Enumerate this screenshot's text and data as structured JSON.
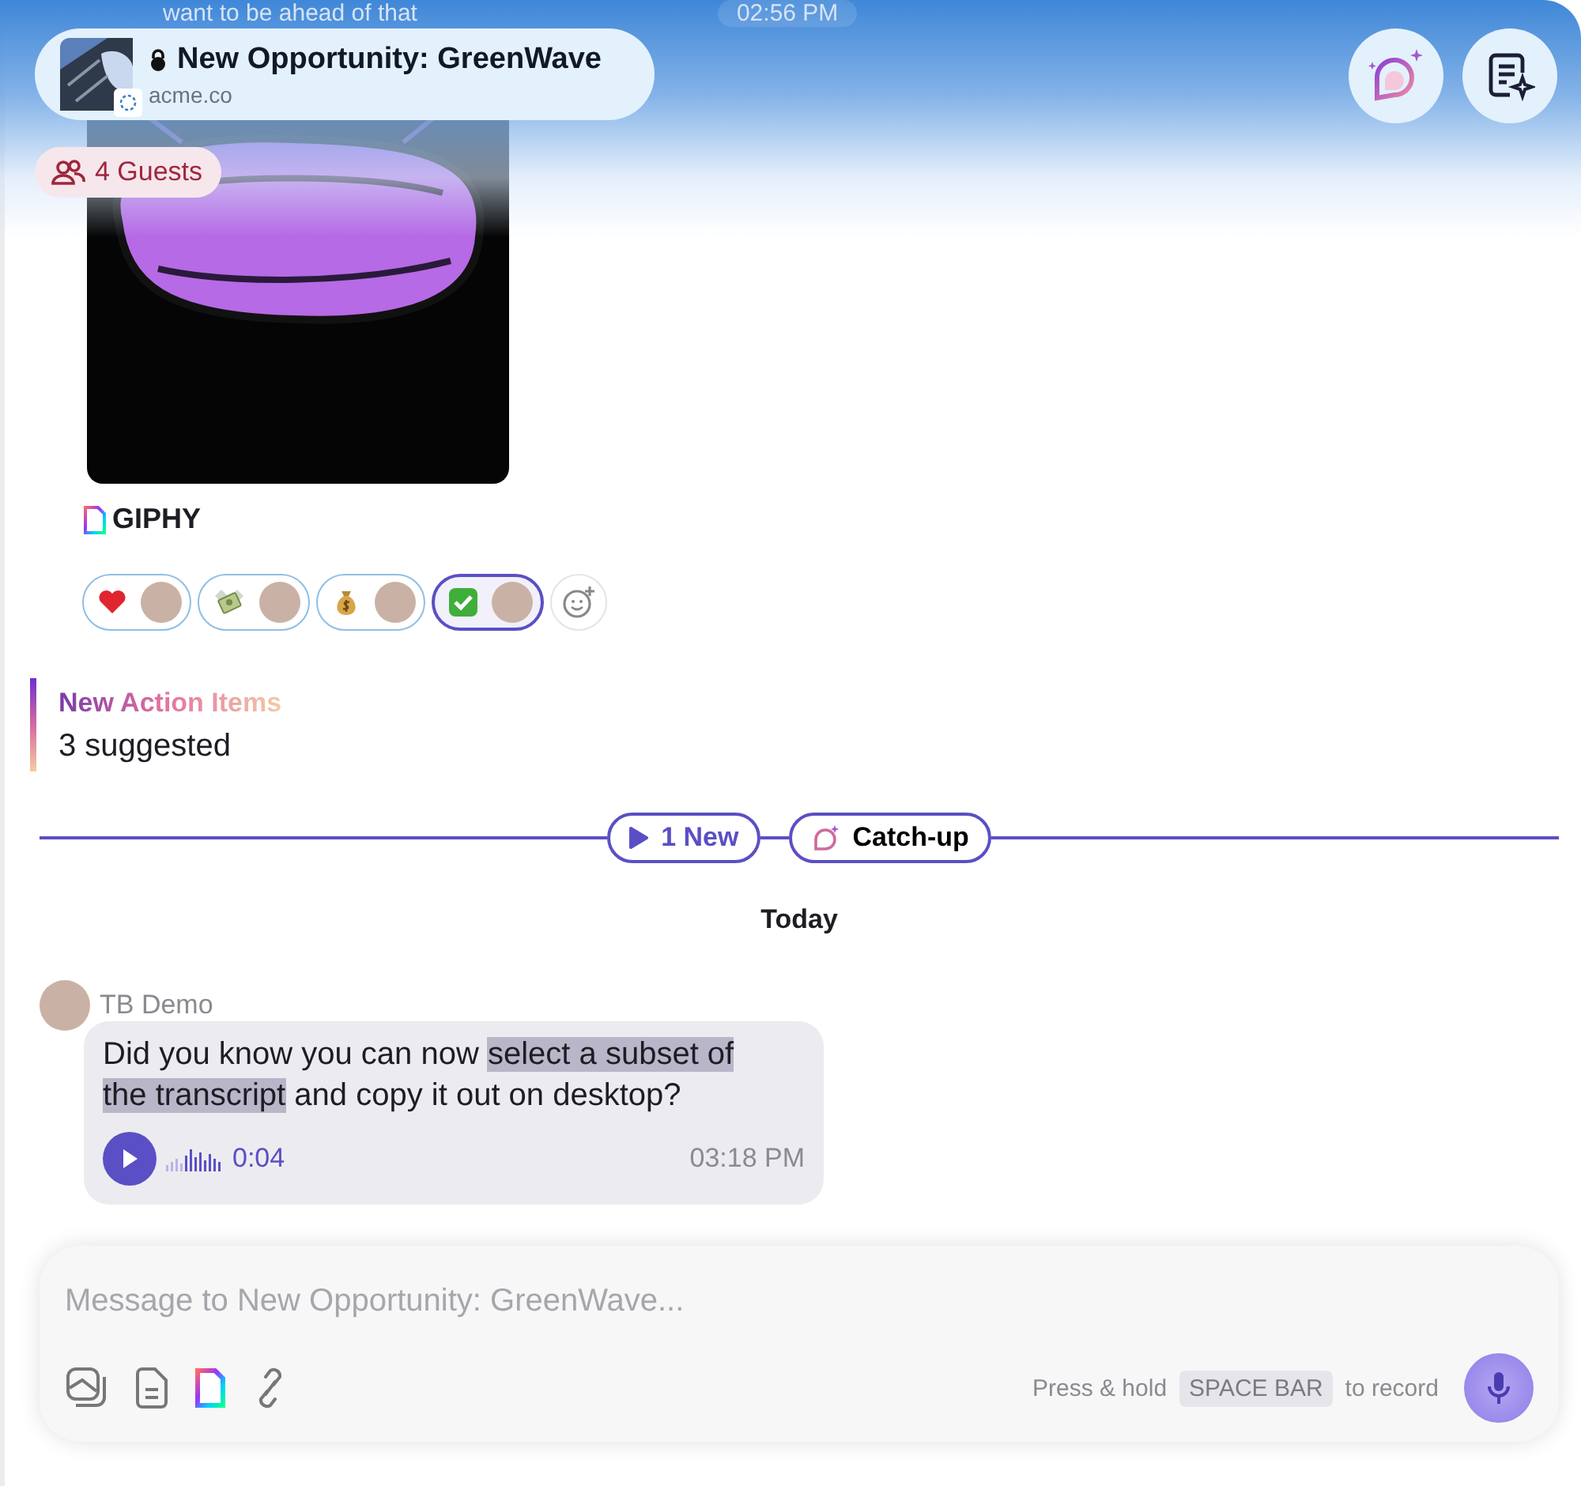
{
  "previous_message": {
    "text": "want to be ahead of that",
    "time": "02:56 PM"
  },
  "header": {
    "title": "New Opportunity: GreenWave",
    "subtitle": "acme.co",
    "locked": true
  },
  "guests": {
    "label": "4 Guests"
  },
  "gif": {
    "kind": "picture",
    "source": "GIPHY"
  },
  "reactions": [
    {
      "kind": "heart",
      "selected": false
    },
    {
      "kind": "money",
      "selected": false
    },
    {
      "kind": "moneybag",
      "selected": false
    },
    {
      "kind": "check",
      "selected": true
    }
  ],
  "action_items": {
    "title": "New Action Items",
    "subtitle": "3 suggested"
  },
  "divider": {
    "new_label": "1 New",
    "catchup_label": "Catch-up"
  },
  "date_label": "Today",
  "message": {
    "sender": "TB Demo",
    "parts": [
      {
        "text": "Did you know you can now ",
        "highlighted": false
      },
      {
        "text": "select a subset of the transcript",
        "highlighted": true
      },
      {
        "text": " and copy it out on desktop?",
        "highlighted": false
      }
    ],
    "duration": "0:04",
    "time": "03:18 PM"
  },
  "composer": {
    "placeholder": "Message to New Opportunity: GreenWave...",
    "hint_before": "Press & hold",
    "key": "SPACE BAR",
    "hint_after": "to record"
  }
}
